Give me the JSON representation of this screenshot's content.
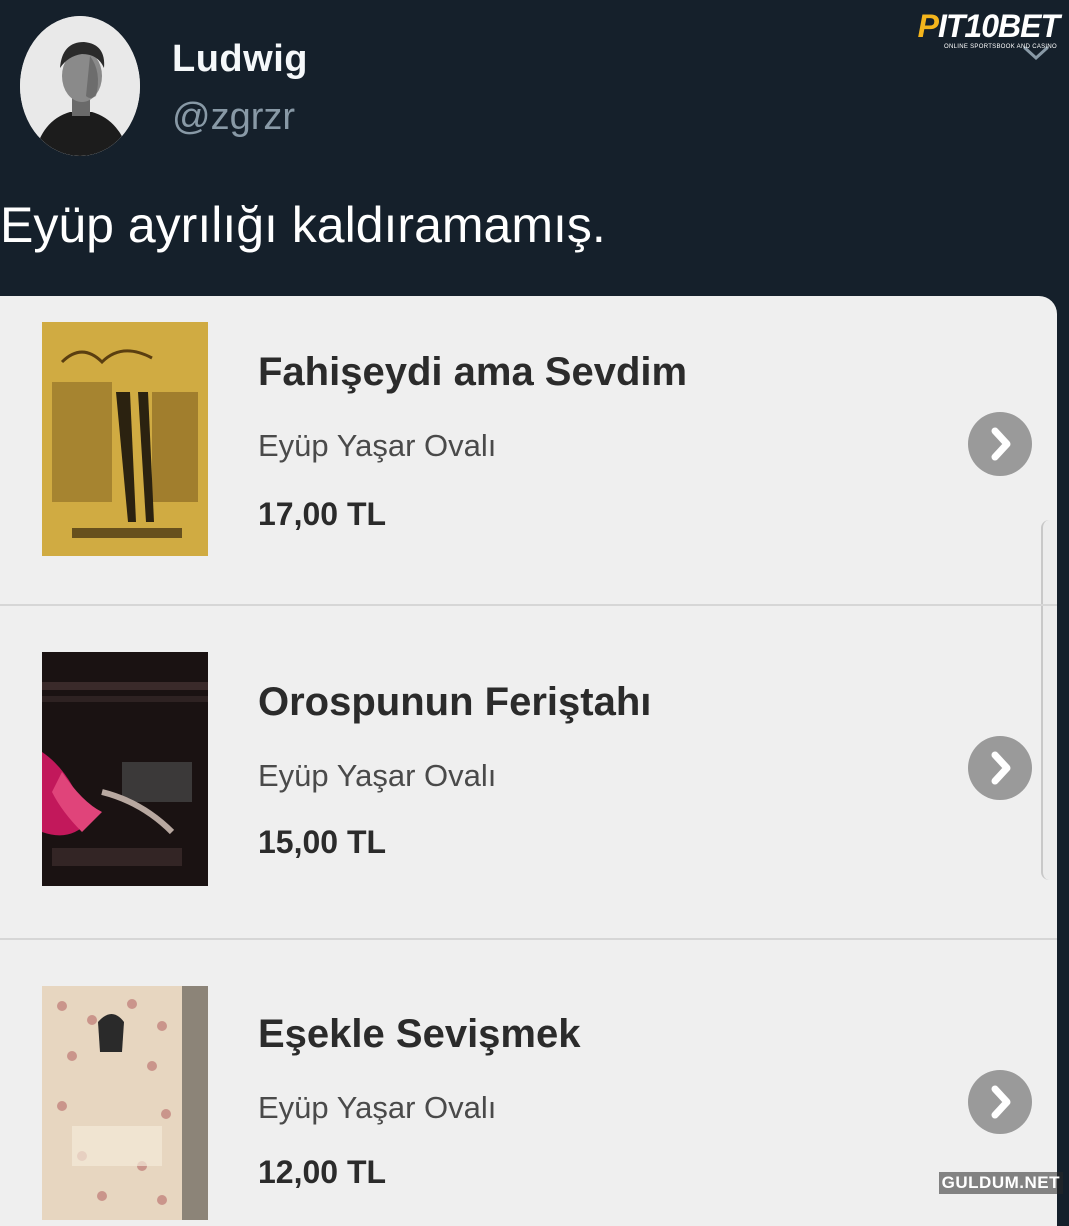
{
  "tweet": {
    "user_name": "Ludwig",
    "user_handle": "@zgrzr",
    "text": "Eyüp ayrılığı kaldıramamış."
  },
  "watermarks": {
    "logo_main": "PIT10BET",
    "logo_sub": "ONLINE SPORTSBOOK AND CASINO",
    "corner": "GULDUM.NET"
  },
  "books": [
    {
      "title": "Fahişeydi ama Sevdim",
      "author": "Eyüp Yaşar Ovalı",
      "price": "17,00 TL",
      "cover_colors": {
        "bg": "#c9a23a",
        "accent": "#2b2210"
      }
    },
    {
      "title": "Orospunun Feriştahı",
      "author": "Eyüp Yaşar Ovalı",
      "price": "15,00 TL",
      "cover_colors": {
        "bg": "#1a1212",
        "accent": "#c2185b"
      }
    },
    {
      "title": "Eşekle Sevişmek",
      "author": "Eyüp Yaşar Ovalı",
      "price": "12,00 TL",
      "cover_colors": {
        "bg": "#e7d6c0",
        "accent": "#8a2a2a"
      }
    }
  ],
  "colors": {
    "page_bg": "#15202b",
    "card_bg": "#efefef",
    "arrow_bg": "#9a9a9a",
    "handle": "#8899a6"
  }
}
